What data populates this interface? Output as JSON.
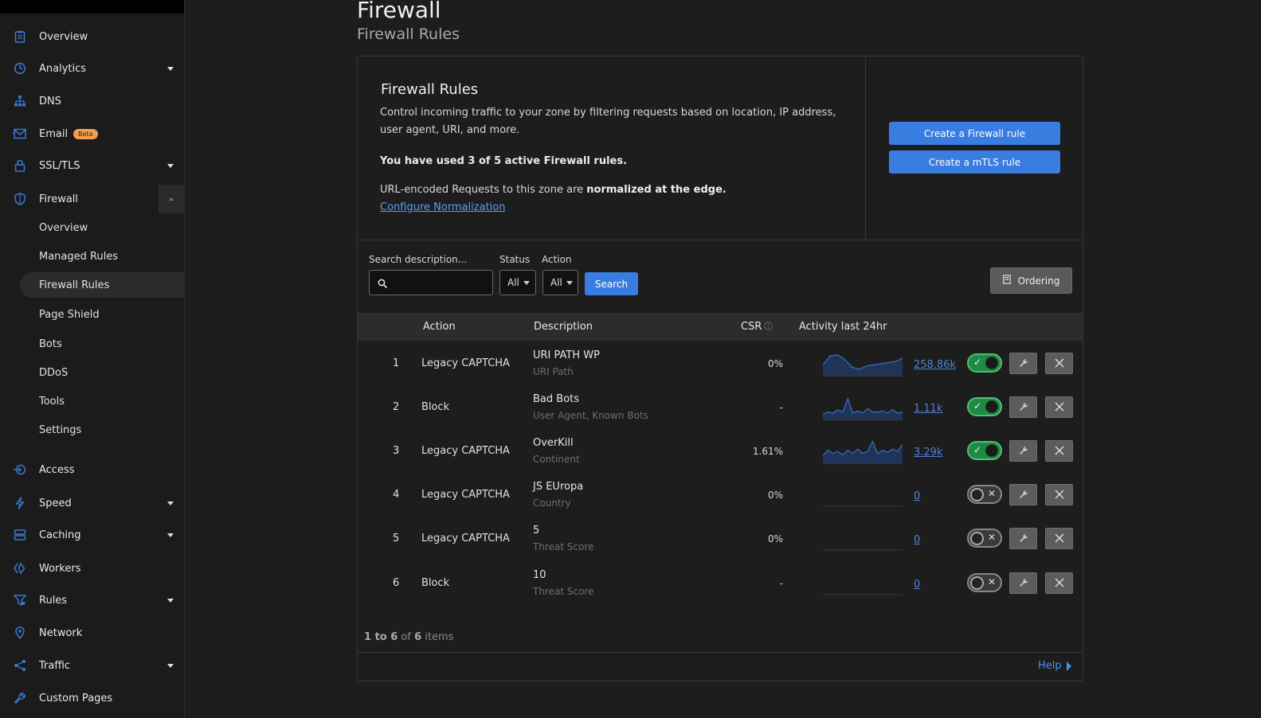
{
  "sidebar": {
    "items": [
      {
        "label": "Overview",
        "icon": "clipboard-icon"
      },
      {
        "label": "Analytics",
        "icon": "clock-chart-icon",
        "caret": true
      },
      {
        "label": "DNS",
        "icon": "sitemap-icon"
      },
      {
        "label": "Email",
        "icon": "envelope-icon",
        "badge": "Beta"
      },
      {
        "label": "SSL/TLS",
        "icon": "lock-icon",
        "caret": true
      },
      {
        "label": "Firewall",
        "icon": "shield-icon",
        "expanded": true
      },
      {
        "label": "Access",
        "icon": "access-icon"
      },
      {
        "label": "Speed",
        "icon": "bolt-icon",
        "caret": true
      },
      {
        "label": "Caching",
        "icon": "server-icon",
        "caret": true
      },
      {
        "label": "Workers",
        "icon": "workers-icon"
      },
      {
        "label": "Rules",
        "icon": "funnel-icon",
        "caret": true
      },
      {
        "label": "Network",
        "icon": "location-pin-icon"
      },
      {
        "label": "Traffic",
        "icon": "share-nodes-icon",
        "caret": true
      },
      {
        "label": "Custom Pages",
        "icon": "wrench-icon"
      }
    ],
    "firewall_sub": [
      "Overview",
      "Managed Rules",
      "Firewall Rules",
      "Page Shield",
      "Bots",
      "DDoS",
      "Tools",
      "Settings"
    ],
    "active_sub": "Firewall Rules"
  },
  "header": {
    "title": "Firewall",
    "subtitle": "Firewall Rules"
  },
  "intro": {
    "title": "Firewall Rules",
    "description": "Control incoming traffic to your zone by filtering requests based on location, IP address, user agent, URI, and more.",
    "usage": "You have used 3 of 5 active Firewall rules.",
    "norm_prefix": "URL-encoded Requests to this zone are ",
    "norm_bold": "normalized at the edge.",
    "link": "Configure Normalization",
    "btn_create_firewall": "Create a Firewall rule",
    "btn_create_mtls": "Create a mTLS rule"
  },
  "filters": {
    "search_label": "Search description...",
    "search_value": "",
    "status_label": "Status",
    "status_value": "All",
    "action_label": "Action",
    "action_value": "All",
    "search_button": "Search",
    "ordering_button": "Ordering"
  },
  "table": {
    "columns": {
      "action": "Action",
      "description": "Description",
      "csr": "CSR",
      "activity": "Activity last 24hr"
    },
    "rows": [
      {
        "num": "1",
        "action": "Legacy CAPTCHA",
        "desc": "URI PATH WP",
        "sub": "URI Path",
        "csr": "0%",
        "count": "258.86k",
        "enabled": true,
        "spark": [
          0.45,
          0.85,
          0.9,
          0.7,
          0.35,
          0.25,
          0.4,
          0.45,
          0.5,
          0.55,
          0.6,
          0.75
        ]
      },
      {
        "num": "2",
        "action": "Block",
        "desc": "Bad Bots",
        "sub": "User Agent, Known Bots",
        "csr": "-",
        "count": "1.11k",
        "enabled": true,
        "spark": [
          0.2,
          0.3,
          0.25,
          0.4,
          0.3,
          0.9,
          0.25,
          0.35,
          0.25,
          0.45,
          0.3,
          0.3,
          0.35,
          0.25,
          0.4,
          0.25,
          0.3
        ]
      },
      {
        "num": "3",
        "action": "Legacy CAPTCHA",
        "desc": "OverKill",
        "sub": "Continent",
        "csr": "1.61%",
        "count": "3.29k",
        "enabled": true,
        "spark": [
          0.3,
          0.55,
          0.4,
          0.5,
          0.35,
          0.55,
          0.4,
          0.6,
          0.4,
          0.5,
          0.95,
          0.4,
          0.55,
          0.45,
          0.6,
          0.5,
          0.8
        ]
      },
      {
        "num": "4",
        "action": "Legacy CAPTCHA",
        "desc": "JS EUropa",
        "sub": "Country",
        "csr": "0%",
        "count": "0",
        "enabled": false,
        "spark": []
      },
      {
        "num": "5",
        "action": "Legacy CAPTCHA",
        "desc": "5",
        "sub": "Threat Score",
        "csr": "0%",
        "count": "0",
        "enabled": false,
        "spark": []
      },
      {
        "num": "6",
        "action": "Block",
        "desc": "10",
        "sub": "Threat Score",
        "csr": "-",
        "count": "0",
        "enabled": false,
        "spark": []
      }
    ]
  },
  "pager": {
    "from": "1",
    "to_word": " to ",
    "to": "6",
    "of_word": " of ",
    "total": "6",
    "items_word": " items"
  },
  "help": "Help",
  "colors": {
    "accent": "#3a7de0",
    "link": "#5a9ef5",
    "toggle_on": "#1d8a45",
    "spark_line": "#3c6fc4"
  }
}
